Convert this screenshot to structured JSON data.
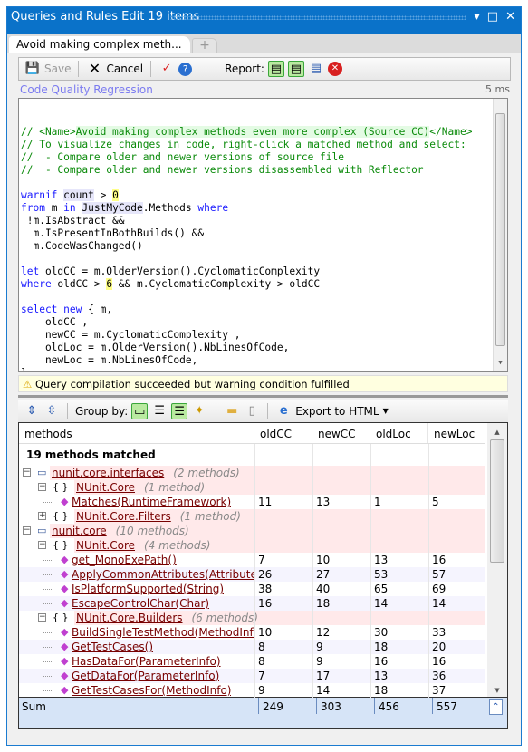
{
  "window": {
    "title": "Queries and Rules Edit  19 items",
    "buttons": [
      "▾",
      "□",
      "✕"
    ]
  },
  "tab": {
    "label": "Avoid making complex meth...",
    "add": "+"
  },
  "toolbar": {
    "save": "Save",
    "cancel": "Cancel",
    "report": "Report:"
  },
  "query": {
    "group": "Code Quality Regression",
    "time": "5 ms"
  },
  "code": [
    [
      [
        "c",
        "// <Name>"
      ],
      [
        "c nm",
        "Avoid making complex methods even more complex (Source CC)"
      ],
      [
        "c",
        "</Name>"
      ]
    ],
    [
      [
        "c",
        "// To visualize changes in code, right-click a matched method and select:"
      ]
    ],
    [
      [
        "c",
        "//  - Compare older and newer versions of source file"
      ]
    ],
    [
      [
        "c",
        "//  - Compare older and newer versions disassembled with Reflector"
      ]
    ],
    [
      [
        "",
        ""
      ]
    ],
    [
      [
        "k",
        "warnif"
      ],
      [
        "",
        " "
      ],
      [
        "hl",
        "count"
      ],
      [
        "",
        " > "
      ],
      [
        "n",
        "0"
      ]
    ],
    [
      [
        "k",
        "from"
      ],
      [
        "",
        " m "
      ],
      [
        "k",
        "in"
      ],
      [
        "",
        " "
      ],
      [
        "hl",
        "JustMyCode"
      ],
      [
        "",
        ".Methods "
      ],
      [
        "k",
        "where"
      ]
    ],
    [
      [
        "",
        " !m.IsAbstract &&"
      ]
    ],
    [
      [
        "",
        "  m.IsPresentInBothBuilds() &&"
      ]
    ],
    [
      [
        "",
        "  m.CodeWasChanged()"
      ]
    ],
    [
      [
        "",
        ""
      ]
    ],
    [
      [
        "k",
        "let"
      ],
      [
        "",
        " oldCC = m.OlderVersion().CyclomaticComplexity"
      ]
    ],
    [
      [
        "k",
        "where"
      ],
      [
        "",
        " oldCC > "
      ],
      [
        "n",
        "6"
      ],
      [
        "",
        " && m.CyclomaticComplexity > oldCC"
      ]
    ],
    [
      [
        "",
        ""
      ]
    ],
    [
      [
        "k",
        "select"
      ],
      [
        "",
        " "
      ],
      [
        "k",
        "new"
      ],
      [
        "",
        " { m,"
      ]
    ],
    [
      [
        "",
        "    oldCC ,"
      ]
    ],
    [
      [
        "",
        "    newCC = m.CyclomaticComplexity ,"
      ]
    ],
    [
      [
        "",
        "    oldLoc = m.OlderVersion().NbLinesOfCode,"
      ]
    ],
    [
      [
        "",
        "    newLoc = m.NbLinesOfCode,"
      ]
    ],
    [
      [
        "",
        "}"
      ]
    ]
  ],
  "status": {
    "message": "Query compilation succeeded but warning condition fulfilled"
  },
  "results_toolbar": {
    "group_by": "Group by:",
    "export": "Export to HTML"
  },
  "grid": {
    "columns": [
      "methods",
      "oldCC",
      "newCC",
      "oldLoc",
      "newLoc"
    ],
    "matched": "19 methods matched",
    "rows": [
      {
        "level": 0,
        "kind": "assembly",
        "name": "nunit.core.interfaces",
        "count": "(2 methods)",
        "exp": "−"
      },
      {
        "level": 1,
        "kind": "namespace",
        "name": "NUnit.Core",
        "count": "(1 method)",
        "exp": "−"
      },
      {
        "level": 2,
        "kind": "method",
        "name": "Matches(RuntimeFramework)",
        "values": [
          "11",
          "13",
          "1",
          "5"
        ]
      },
      {
        "level": 1,
        "kind": "namespace",
        "name": "NUnit.Core.Filters",
        "count": "(1 method)",
        "exp": "+"
      },
      {
        "level": 0,
        "kind": "assembly",
        "name": "nunit.core",
        "count": "(10 methods)",
        "exp": "−"
      },
      {
        "level": 1,
        "kind": "namespace",
        "name": "NUnit.Core",
        "count": "(4 methods)",
        "exp": "−"
      },
      {
        "level": 2,
        "kind": "method",
        "name": "get_MonoExePath()",
        "values": [
          "7",
          "10",
          "13",
          "16"
        ]
      },
      {
        "level": 2,
        "kind": "method",
        "name": "ApplyCommonAttributes(Attribute[],Te",
        "values": [
          "26",
          "27",
          "53",
          "57"
        ]
      },
      {
        "level": 2,
        "kind": "method",
        "name": "IsPlatformSupported(String)",
        "values": [
          "38",
          "40",
          "65",
          "69"
        ]
      },
      {
        "level": 2,
        "kind": "method",
        "name": "EscapeControlChar(Char)",
        "values": [
          "16",
          "18",
          "14",
          "14"
        ]
      },
      {
        "level": 1,
        "kind": "namespace",
        "name": "NUnit.Core.Builders",
        "count": "(6 methods)",
        "exp": "−"
      },
      {
        "level": 2,
        "kind": "method",
        "name": "BuildSingleTestMethod(MethodInfo,Te",
        "values": [
          "10",
          "12",
          "30",
          "33"
        ]
      },
      {
        "level": 2,
        "kind": "method",
        "name": "GetTestCases()",
        "values": [
          "8",
          "9",
          "18",
          "20"
        ]
      },
      {
        "level": 2,
        "kind": "method",
        "name": "HasDataFor(ParameterInfo)",
        "values": [
          "8",
          "9",
          "16",
          "16"
        ]
      },
      {
        "level": 2,
        "kind": "method",
        "name": "GetDataFor(ParameterInfo)",
        "values": [
          "7",
          "17",
          "13",
          "36"
        ]
      },
      {
        "level": 2,
        "kind": "method",
        "name": "GetTestCasesFor(MethodInfo)",
        "values": [
          "9",
          "14",
          "18",
          "37"
        ]
      }
    ],
    "sum": {
      "label": "Sum",
      "values": [
        "249",
        "303",
        "456",
        "557"
      ]
    }
  }
}
